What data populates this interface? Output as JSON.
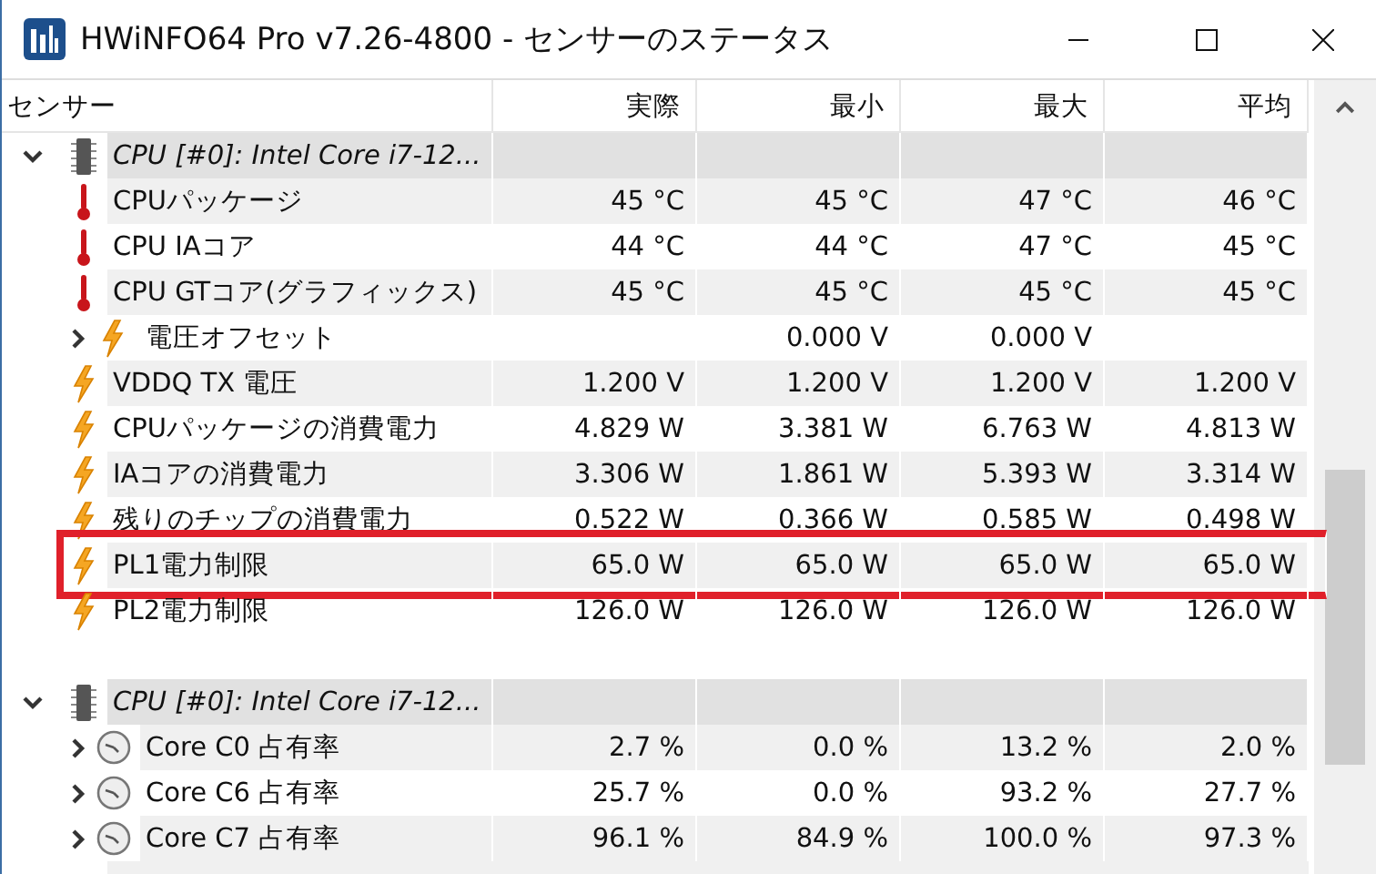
{
  "window": {
    "title": "HWiNFO64 Pro v7.26-4800 - センサーのステータス"
  },
  "table": {
    "columns": [
      "センサー",
      "実際",
      "最小",
      "最大",
      "平均"
    ],
    "groups": [
      {
        "label": "CPU [#0]: Intel Core i7-12...",
        "expanded": true,
        "rows": [
          {
            "kind": "temperature",
            "label": "CPUパッケージ",
            "expandable": false,
            "highlighted": false,
            "current": "45 °C",
            "min": "45 °C",
            "max": "47 °C",
            "avg": "46 °C"
          },
          {
            "kind": "temperature",
            "label": "CPU IAコア",
            "expandable": false,
            "highlighted": false,
            "current": "44 °C",
            "min": "44 °C",
            "max": "47 °C",
            "avg": "45 °C"
          },
          {
            "kind": "temperature",
            "label": "CPU GTコア(グラフィックス)",
            "expandable": false,
            "highlighted": false,
            "current": "45 °C",
            "min": "45 °C",
            "max": "45 °C",
            "avg": "45 °C"
          },
          {
            "kind": "power",
            "label": "電圧オフセット",
            "expandable": true,
            "highlighted": false,
            "min": "0.000 V",
            "max": "0.000 V"
          },
          {
            "kind": "power",
            "label": "VDDQ TX 電圧",
            "expandable": false,
            "highlighted": false,
            "current": "1.200 V",
            "min": "1.200 V",
            "max": "1.200 V",
            "avg": "1.200 V"
          },
          {
            "kind": "power",
            "label": "CPUパッケージの消費電力",
            "expandable": false,
            "highlighted": false,
            "current": "4.829 W",
            "min": "3.381 W",
            "max": "6.763 W",
            "avg": "4.813 W"
          },
          {
            "kind": "power",
            "label": "IAコアの消費電力",
            "expandable": false,
            "highlighted": false,
            "current": "3.306 W",
            "min": "1.861 W",
            "max": "5.393 W",
            "avg": "3.314 W"
          },
          {
            "kind": "power",
            "label": "残りのチップの消費電力",
            "expandable": false,
            "highlighted": false,
            "current": "0.522 W",
            "min": "0.366 W",
            "max": "0.585 W",
            "avg": "0.498 W"
          },
          {
            "kind": "power",
            "label": "PL1電力制限",
            "expandable": false,
            "highlighted": true,
            "current": "65.0 W",
            "min": "65.0 W",
            "max": "65.0 W",
            "avg": "65.0 W"
          },
          {
            "kind": "power",
            "label": "PL2電力制限",
            "expandable": false,
            "highlighted": false,
            "current": "126.0 W",
            "min": "126.0 W",
            "max": "126.0 W",
            "avg": "126.0 W"
          }
        ]
      },
      {
        "label": "CPU [#0]: Intel Core i7-12...",
        "expanded": true,
        "rows": [
          {
            "kind": "clock",
            "label": "Core C0 占有率",
            "expandable": true,
            "highlighted": false,
            "current": "2.7 %",
            "min": "0.0 %",
            "max": "13.2 %",
            "avg": "2.0 %"
          },
          {
            "kind": "clock",
            "label": "Core C6 占有率",
            "expandable": true,
            "highlighted": false,
            "current": "25.7 %",
            "min": "0.0 %",
            "max": "93.2 %",
            "avg": "27.7 %"
          },
          {
            "kind": "clock",
            "label": "Core C7 占有率",
            "expandable": true,
            "highlighted": false,
            "current": "96.1 %",
            "min": "84.9 %",
            "max": "100.0 %",
            "avg": "97.3 %"
          }
        ]
      }
    ]
  }
}
